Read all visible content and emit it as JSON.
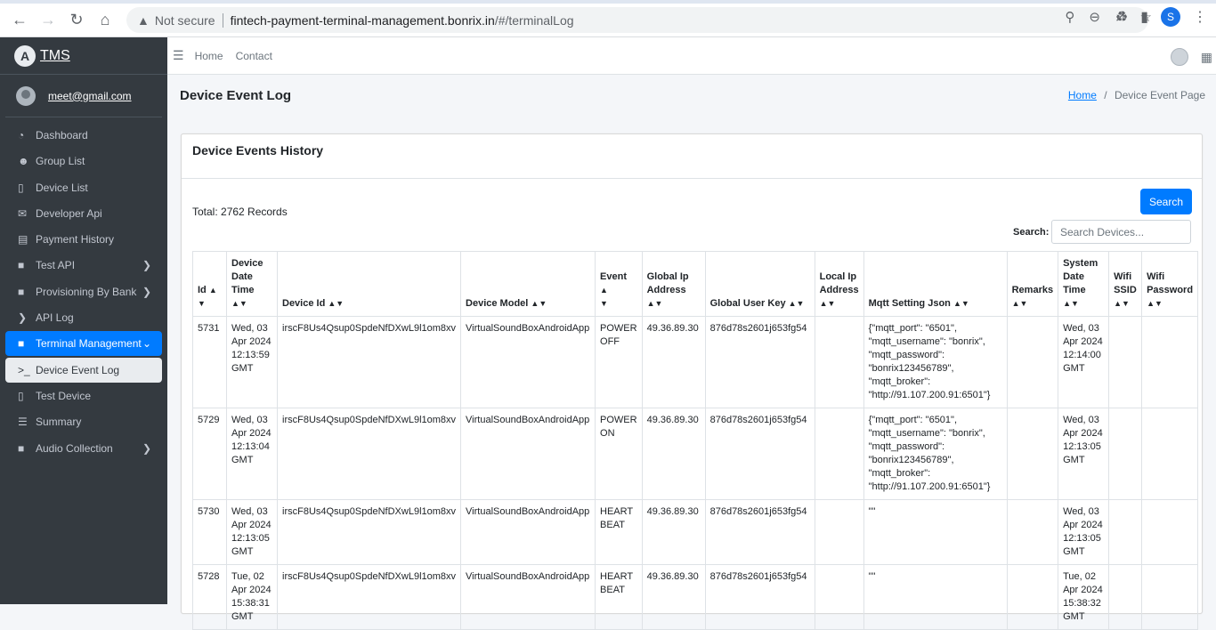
{
  "browser": {
    "not_secure": "Not secure",
    "url_host": "fintech-payment-terminal-management.bonrix.in",
    "url_path": "/#/terminalLog",
    "profile_initial": "S"
  },
  "brand": {
    "logo_letter": "A",
    "name": "TMS"
  },
  "user": {
    "email": "meet@gmail.com"
  },
  "sidebar": {
    "items": [
      {
        "label": "Dashboard",
        "icon": "dashboard-icon"
      },
      {
        "label": "Group List",
        "icon": "users-icon"
      },
      {
        "label": "Device List",
        "icon": "mobile-icon"
      },
      {
        "label": "Developer Api",
        "icon": "envelope-open-icon"
      },
      {
        "label": "Payment History",
        "icon": "newspaper-icon"
      },
      {
        "label": "Test API",
        "icon": "folder-icon"
      },
      {
        "label": "Provisioning By Bank",
        "icon": "folder-icon"
      },
      {
        "label": "API Log",
        "icon": "chevron-right-icon"
      },
      {
        "label": "Terminal Management",
        "icon": "folder-icon"
      },
      {
        "label": "Device Event Log",
        "icon": "terminal-icon"
      },
      {
        "label": "Test Device",
        "icon": "mobile-icon"
      },
      {
        "label": "Summary",
        "icon": "list-icon"
      },
      {
        "label": "Audio Collection",
        "icon": "folder-icon"
      }
    ]
  },
  "navbar": {
    "home": "Home",
    "contact": "Contact"
  },
  "page": {
    "title": "Device Event Log",
    "breadcrumb_home": "Home",
    "breadcrumb_sep": "/",
    "breadcrumb_current": "Device Event Page"
  },
  "card": {
    "title": "Device Events History",
    "total": "Total: 2762 Records",
    "search_button": "Search",
    "search_label": "Search:",
    "search_placeholder": "Search Devices..."
  },
  "table": {
    "headers": [
      "Id",
      "Device Date Time",
      "Device Id",
      "Device Model",
      "Event",
      "Global Ip Address",
      "Global User Key",
      "Local Ip Address",
      "Mqtt Setting Json",
      "Remarks",
      "System Date Time",
      "Wifi SSID",
      "Wifi Password"
    ],
    "rows": [
      {
        "id": "5731",
        "device_date_time": "Wed, 03 Apr 2024 12:13:59 GMT",
        "device_id": "irscF8Us4Qsup0SpdeNfDXwL9l1om8xv",
        "device_model": "VirtualSoundBoxAndroidApp",
        "event": "POWER OFF",
        "global_ip": "49.36.89.30",
        "global_user_key": "876d78s2601j653fg54",
        "local_ip": "",
        "mqtt_json": "{\"mqtt_port\": \"6501\", \"mqtt_username\": \"bonrix\", \"mqtt_password\": \"bonrix123456789\", \"mqtt_broker\": \"http://91.107.200.91:6501\"}",
        "remarks": "",
        "system_date_time": "Wed, 03 Apr 2024 12:14:00 GMT",
        "wifi_ssid": "",
        "wifi_password": ""
      },
      {
        "id": "5729",
        "device_date_time": "Wed, 03 Apr 2024 12:13:04 GMT",
        "device_id": "irscF8Us4Qsup0SpdeNfDXwL9l1om8xv",
        "device_model": "VirtualSoundBoxAndroidApp",
        "event": "POWER ON",
        "global_ip": "49.36.89.30",
        "global_user_key": "876d78s2601j653fg54",
        "local_ip": "",
        "mqtt_json": "{\"mqtt_port\": \"6501\", \"mqtt_username\": \"bonrix\", \"mqtt_password\": \"bonrix123456789\", \"mqtt_broker\": \"http://91.107.200.91:6501\"}",
        "remarks": "",
        "system_date_time": "Wed, 03 Apr 2024 12:13:05 GMT",
        "wifi_ssid": "",
        "wifi_password": ""
      },
      {
        "id": "5730",
        "device_date_time": "Wed, 03 Apr 2024 12:13:05 GMT",
        "device_id": "irscF8Us4Qsup0SpdeNfDXwL9l1om8xv",
        "device_model": "VirtualSoundBoxAndroidApp",
        "event": "HEART BEAT",
        "global_ip": "49.36.89.30",
        "global_user_key": "876d78s2601j653fg54",
        "local_ip": "",
        "mqtt_json": "\"\"",
        "remarks": "",
        "system_date_time": "Wed, 03 Apr 2024 12:13:05 GMT",
        "wifi_ssid": "",
        "wifi_password": ""
      },
      {
        "id": "5728",
        "device_date_time": "Tue, 02 Apr 2024 15:38:31 GMT",
        "device_id": "irscF8Us4Qsup0SpdeNfDXwL9l1om8xv",
        "device_model": "VirtualSoundBoxAndroidApp",
        "event": "HEART BEAT",
        "global_ip": "49.36.89.30",
        "global_user_key": "876d78s2601j653fg54",
        "local_ip": "",
        "mqtt_json": "\"\"",
        "remarks": "",
        "system_date_time": "Tue, 02 Apr 2024 15:38:32 GMT",
        "wifi_ssid": "",
        "wifi_password": ""
      }
    ]
  },
  "colors": {
    "sidebar_bg": "#343a40",
    "active_bg": "#007bff",
    "sub_active_bg": "#e9ecef",
    "primary": "#007bff"
  }
}
